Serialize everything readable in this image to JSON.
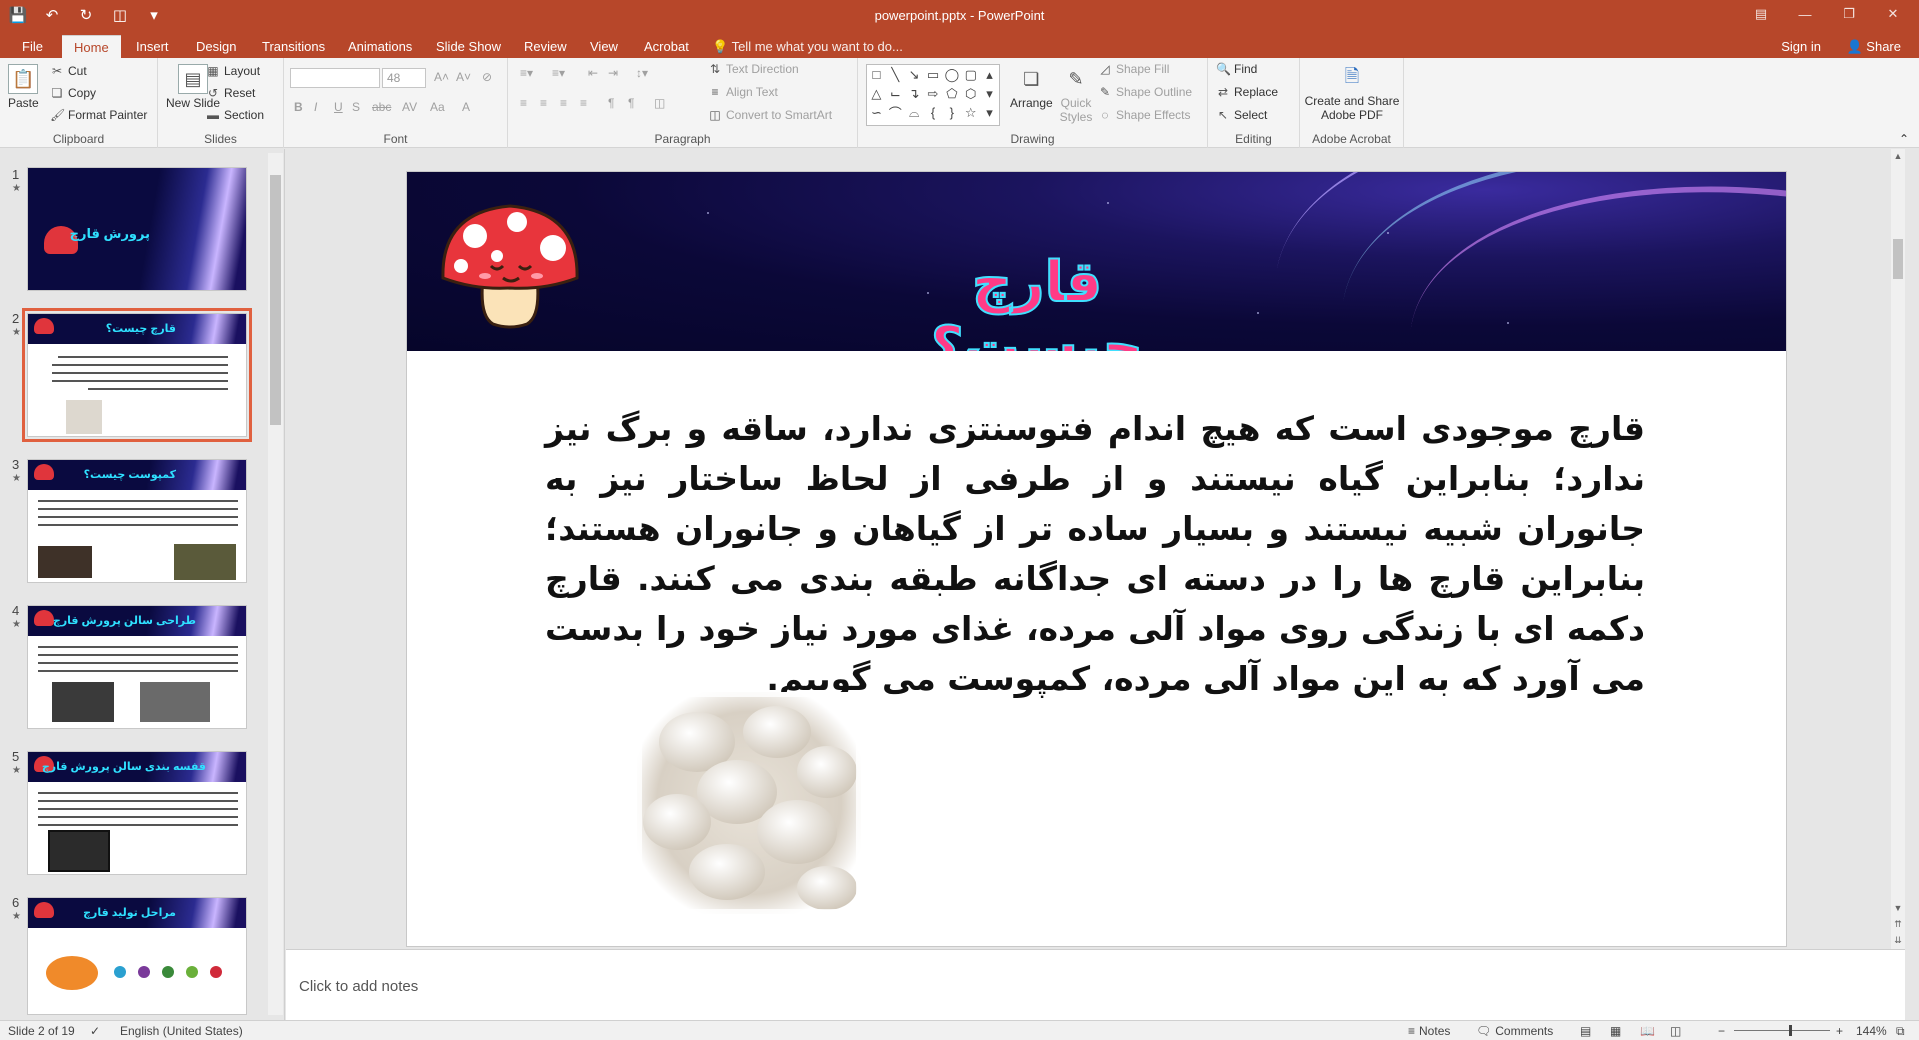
{
  "window": {
    "title": "powerpoint.pptx - PowerPoint",
    "controls": [
      "restore-ribbon",
      "minimize",
      "maximize",
      "close"
    ]
  },
  "tabs": [
    {
      "label": "File",
      "active": false
    },
    {
      "label": "Home",
      "active": true
    },
    {
      "label": "Insert",
      "active": false
    },
    {
      "label": "Design",
      "active": false
    },
    {
      "label": "Transitions",
      "active": false
    },
    {
      "label": "Animations",
      "active": false
    },
    {
      "label": "Slide Show",
      "active": false
    },
    {
      "label": "Review",
      "active": false
    },
    {
      "label": "View",
      "active": false
    },
    {
      "label": "Acrobat",
      "active": false
    }
  ],
  "tell_me": "Tell me what you want to do...",
  "sign_in": "Sign in",
  "share": "Share",
  "ribbon": {
    "clipboard": {
      "label": "Clipboard",
      "paste": "Paste",
      "cut": "Cut",
      "copy": "Copy",
      "format_painter": "Format Painter"
    },
    "slides": {
      "label": "Slides",
      "new_slide": "New Slide",
      "layout": "Layout",
      "reset": "Reset",
      "section": "Section"
    },
    "font": {
      "label": "Font",
      "font_size": "48"
    },
    "paragraph": {
      "label": "Paragraph",
      "text_direction": "Text Direction",
      "align_text": "Align Text",
      "convert_smartart": "Convert to SmartArt"
    },
    "drawing": {
      "label": "Drawing",
      "arrange": "Arrange",
      "quick_styles": "Quick Styles",
      "shape_fill": "Shape Fill",
      "shape_outline": "Shape Outline",
      "shape_effects": "Shape Effects"
    },
    "editing": {
      "label": "Editing",
      "find": "Find",
      "replace": "Replace",
      "select": "Select"
    },
    "acrobat": {
      "label": "Adobe Acrobat",
      "create_share": "Create and Share",
      "adobe_pdf": "Adobe PDF"
    }
  },
  "thumbnails": [
    {
      "number": "1",
      "title": "پرورش قارچ"
    },
    {
      "number": "2",
      "title": "قارچ چیست؟"
    },
    {
      "number": "3",
      "title": "کمپوست چیست؟"
    },
    {
      "number": "4",
      "title": "طراحی سالن پرورش قارچ"
    },
    {
      "number": "5",
      "title": "قفسه بندی سالن پرورش قارچ"
    },
    {
      "number": "6",
      "title": "مراحل تولید قارچ"
    }
  ],
  "slide": {
    "title": "قارچ چیست؟",
    "body": "قارچ موجودی است که هیچ اندام فتوسنتزی ندارد، ساقه و برگ نیز ندارد؛ بنابراین گیاه نیستند و از طرفی از لحاظ ساختار نیز به جانوران شبیه نیستند و بسیار ساده تر از گیاهان و جانوران هستند؛ بنابراین قارچ ها را در دسته ای جداگانه طبقه بندی می کنند. قارچ دکمه ای با زندگی روی مواد آلی مرده، غذای مورد نیاز خود را بدست می آورد که به این مواد آلی مرده، کمپوست می گوییم."
  },
  "notes": {
    "placeholder": "Click to add notes"
  },
  "status": {
    "slide": "Slide 2 of 19",
    "language": "English (United States)",
    "notes": "Notes",
    "comments": "Comments",
    "zoom": "144%"
  },
  "colors": {
    "accent": "#b7472a",
    "selection": "#e0603f",
    "title_fill": "#ff3b86",
    "title_outline": "#40e0ff"
  }
}
